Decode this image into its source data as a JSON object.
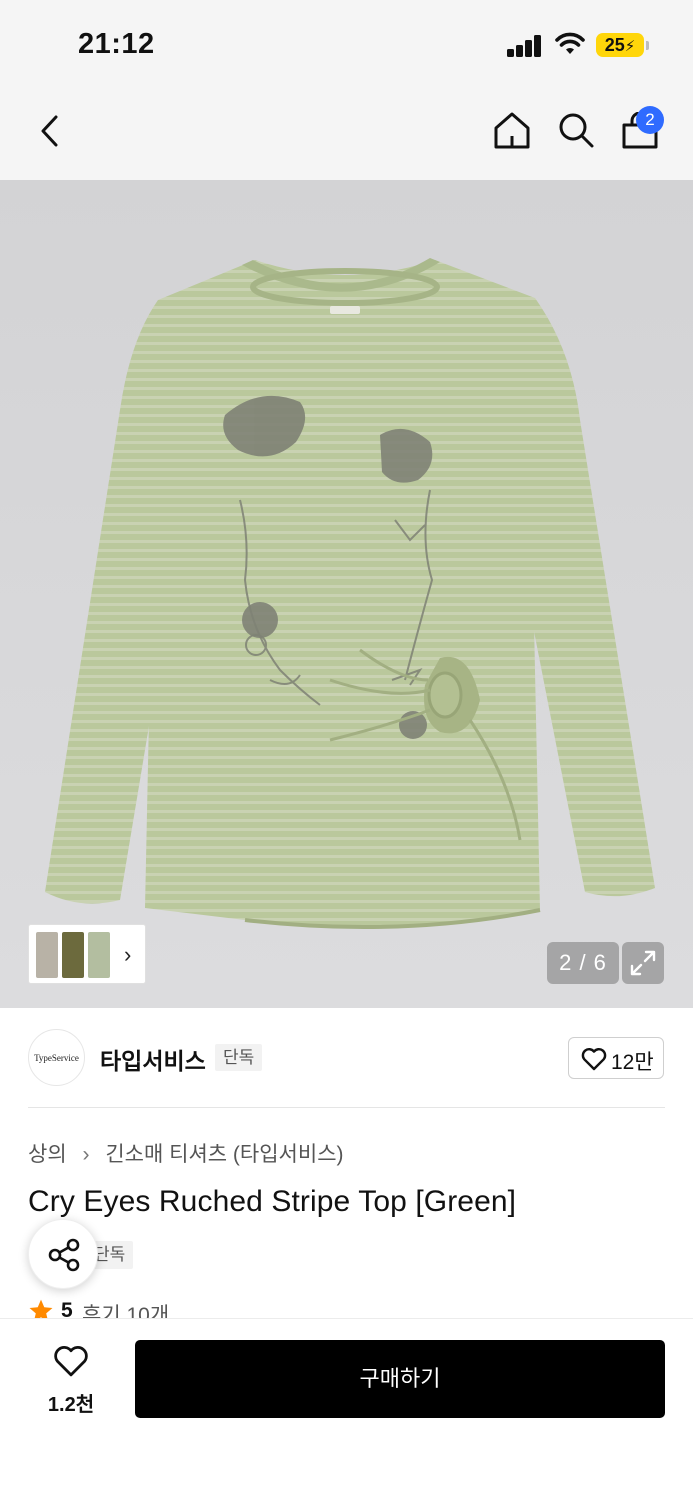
{
  "status_bar": {
    "time": "21:12",
    "battery": "25"
  },
  "header": {
    "cart_count": "2",
    "icons": [
      "back-icon",
      "home-icon",
      "search-icon",
      "shopping-bag-icon"
    ]
  },
  "gallery": {
    "counter": "2 / 6",
    "current_index": 2,
    "total": 6,
    "background_color": "#d6d6d8",
    "garment_color": "#b8c69a"
  },
  "brand": {
    "logo_text": "TypeService",
    "name": "타입서비스",
    "badge": "단독",
    "likes": "12만"
  },
  "breadcrumb": {
    "category": "상의",
    "subcategory": "긴소매 티셔츠 (타입서비스)"
  },
  "product": {
    "title": "Cry Eyes Ruched Stripe Top [Green]",
    "exclusive_tag": "단독",
    "rating": "5",
    "reviews": "후기 10개"
  },
  "bottom_bar": {
    "wish_count": "1.2천",
    "buy_label": "구매하기"
  },
  "colors": {
    "accent_blue": "#2f6bff",
    "battery_yellow": "#ffd60a",
    "star_orange": "#ff8a00",
    "buy_button": "#000000"
  }
}
